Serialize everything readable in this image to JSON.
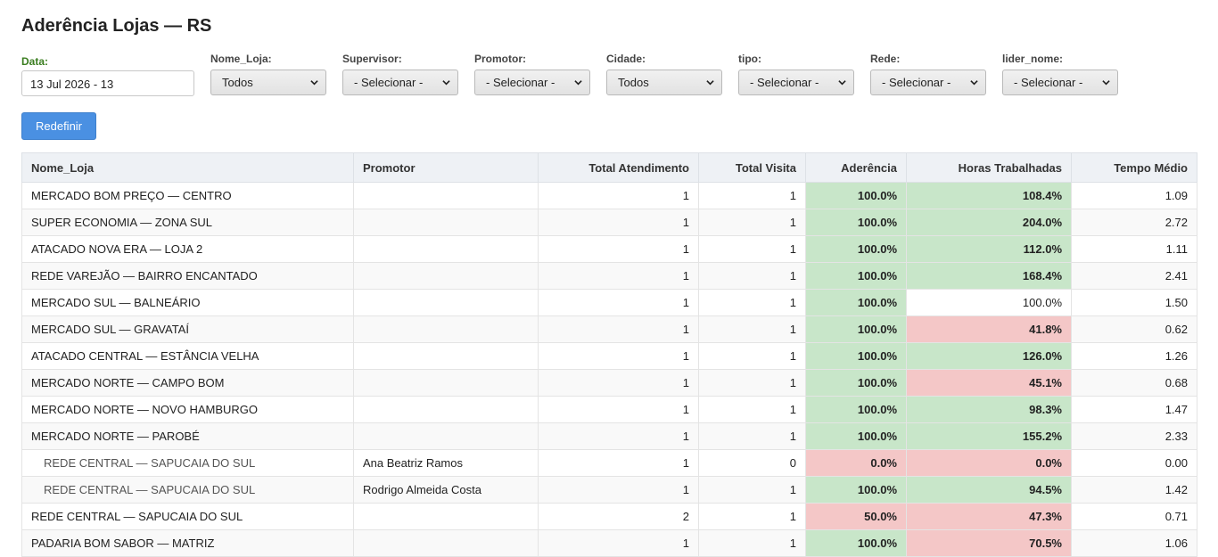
{
  "page": {
    "title": "Aderência Lojas — RS"
  },
  "filters": {
    "date": {
      "label": "Data:",
      "value": "13 Jul 2026 - 13"
    },
    "nome_loja": {
      "label": "Nome_Loja:",
      "value": "Todos"
    },
    "supervisor": {
      "label": "Supervisor:",
      "value": "- Selecionar -"
    },
    "promotor": {
      "label": "Promotor:",
      "value": "- Selecionar -"
    },
    "cidade": {
      "label": "Cidade:",
      "value": "Todos"
    },
    "tipo": {
      "label": "tipo:",
      "value": "- Selecionar -"
    },
    "rede": {
      "label": "Rede:",
      "value": "- Selecionar -"
    },
    "lider_nome": {
      "label": "lider_nome:",
      "value": "- Selecionar -"
    }
  },
  "reset_button": {
    "label": "Redefinir"
  },
  "table": {
    "columns": [
      "Nome_Loja",
      "Promotor",
      "Total Atendimento",
      "Total Visita",
      "Aderência",
      "Horas Trabalhadas",
      "Tempo Médio"
    ],
    "rows": [
      {
        "nome": "MERCADO BOM PREÇO — CENTRO",
        "promotor": "",
        "atend": "1",
        "visita": "1",
        "aderencia": "100.0%",
        "ader_status": "good",
        "horas": "108.4%",
        "horas_status": "good",
        "tempo": "1.09",
        "sub": false
      },
      {
        "nome": "SUPER ECONOMIA — ZONA SUL",
        "promotor": "",
        "atend": "1",
        "visita": "1",
        "aderencia": "100.0%",
        "ader_status": "good",
        "horas": "204.0%",
        "horas_status": "good",
        "tempo": "2.72",
        "sub": false
      },
      {
        "nome": "ATACADO NOVA ERA — LOJA 2",
        "promotor": "",
        "atend": "1",
        "visita": "1",
        "aderencia": "100.0%",
        "ader_status": "good",
        "horas": "112.0%",
        "horas_status": "good",
        "tempo": "1.11",
        "sub": false
      },
      {
        "nome": "REDE VAREJÃO — BAIRRO ENCANTADO",
        "promotor": "",
        "atend": "1",
        "visita": "1",
        "aderencia": "100.0%",
        "ader_status": "good",
        "horas": "168.4%",
        "horas_status": "good",
        "tempo": "2.41",
        "sub": false
      },
      {
        "nome": "MERCADO SUL — BALNEÁRIO",
        "promotor": "",
        "atend": "1",
        "visita": "1",
        "aderencia": "100.0%",
        "ader_status": "good",
        "horas": "100.0%",
        "horas_status": "plain",
        "tempo": "1.50",
        "sub": false
      },
      {
        "nome": "MERCADO SUL — GRAVATAÍ",
        "promotor": "",
        "atend": "1",
        "visita": "1",
        "aderencia": "100.0%",
        "ader_status": "good",
        "horas": "41.8%",
        "horas_status": "bad",
        "tempo": "0.62",
        "sub": false
      },
      {
        "nome": "ATACADO CENTRAL — ESTÂNCIA VELHA",
        "promotor": "",
        "atend": "1",
        "visita": "1",
        "aderencia": "100.0%",
        "ader_status": "good",
        "horas": "126.0%",
        "horas_status": "good",
        "tempo": "1.26",
        "sub": false
      },
      {
        "nome": "MERCADO NORTE — CAMPO BOM",
        "promotor": "",
        "atend": "1",
        "visita": "1",
        "aderencia": "100.0%",
        "ader_status": "good",
        "horas": "45.1%",
        "horas_status": "bad",
        "tempo": "0.68",
        "sub": false
      },
      {
        "nome": "MERCADO NORTE — NOVO HAMBURGO",
        "promotor": "",
        "atend": "1",
        "visita": "1",
        "aderencia": "100.0%",
        "ader_status": "good",
        "horas": "98.3%",
        "horas_status": "good",
        "tempo": "1.47",
        "sub": false
      },
      {
        "nome": "MERCADO NORTE — PAROBÉ",
        "promotor": "",
        "atend": "1",
        "visita": "1",
        "aderencia": "100.0%",
        "ader_status": "good",
        "horas": "155.2%",
        "horas_status": "good",
        "tempo": "2.33",
        "sub": false
      },
      {
        "nome": "REDE CENTRAL — SAPUCAIA DO SUL",
        "promotor": "Ana Beatriz Ramos",
        "atend": "1",
        "visita": "0",
        "aderencia": "0.0%",
        "ader_status": "bad",
        "horas": "0.0%",
        "horas_status": "bad",
        "tempo": "0.00",
        "sub": true
      },
      {
        "nome": "REDE CENTRAL — SAPUCAIA DO SUL",
        "promotor": "Rodrigo Almeida Costa",
        "atend": "1",
        "visita": "1",
        "aderencia": "100.0%",
        "ader_status": "good",
        "horas": "94.5%",
        "horas_status": "good",
        "tempo": "1.42",
        "sub": true
      },
      {
        "nome": "REDE CENTRAL — SAPUCAIA DO SUL",
        "promotor": "",
        "atend": "2",
        "visita": "1",
        "aderencia": "50.0%",
        "ader_status": "bad",
        "horas": "47.3%",
        "horas_status": "bad",
        "tempo": "0.71",
        "sub": false
      },
      {
        "nome": "PADARIA BOM SABOR — MATRIZ",
        "promotor": "",
        "atend": "1",
        "visita": "1",
        "aderencia": "100.0%",
        "ader_status": "good",
        "horas": "70.5%",
        "horas_status": "bad",
        "tempo": "1.06",
        "sub": false
      }
    ]
  },
  "colors": {
    "good": "#c8e6c9",
    "bad": "#f4c7c7",
    "button": "#4a90e2",
    "date_label": "#3a7d1f"
  }
}
